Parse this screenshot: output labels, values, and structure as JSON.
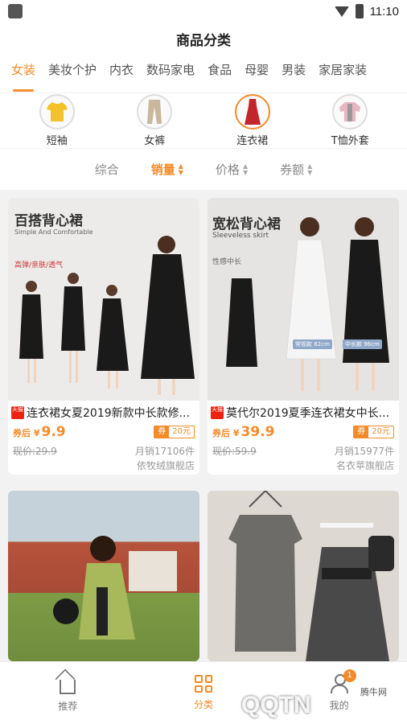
{
  "status_bar": {
    "time": "11:10"
  },
  "header": {
    "title": "商品分类"
  },
  "category_tabs": [
    {
      "label": "女装",
      "active": true
    },
    {
      "label": "美妆个护"
    },
    {
      "label": "内衣"
    },
    {
      "label": "数码家电"
    },
    {
      "label": "食品"
    },
    {
      "label": "母婴"
    },
    {
      "label": "男装"
    },
    {
      "label": "家居家装"
    }
  ],
  "sub_categories": [
    {
      "label": "短袖"
    },
    {
      "label": "女裤"
    },
    {
      "label": "连衣裙",
      "active": true
    },
    {
      "label": "T恤外套"
    }
  ],
  "sort_options": [
    {
      "label": "综合"
    },
    {
      "label": "销量",
      "active": true
    },
    {
      "label": "价格"
    },
    {
      "label": "券额"
    }
  ],
  "products": [
    {
      "image_title": "百搭背心裙",
      "image_subtitle": "Simple And Comfortable",
      "image_tag": "高弹/亲肤/透气",
      "badge": "天猫",
      "title": "连衣裙女夏2019新款中长款修...",
      "price_prefix": "券后 ¥",
      "price": "9.9",
      "coupon_label": "券",
      "coupon_value": "20元",
      "original_price": "现价:29.9",
      "monthly_sales": "月销17106件",
      "shop": "依牧绒旗舰店"
    },
    {
      "image_title": "宽松背心裙",
      "image_subtitle": "Sleeveless skirt",
      "image_tag": "性感中长",
      "image_label_a": "常规款 82cm",
      "image_label_b": "中长款 96cm",
      "badge": "天猫",
      "title": "莫代尔2019夏季连衣裙女中长...",
      "price_prefix": "券后 ¥",
      "price": "39.9",
      "coupon_label": "券",
      "coupon_value": "20元",
      "original_price": "现价:59.9",
      "monthly_sales": "月销15977件",
      "shop": "名衣苹旗舰店"
    },
    {
      "title": ""
    },
    {
      "title": ""
    }
  ],
  "tab_bar": [
    {
      "label": "推荐",
      "icon": "home-icon"
    },
    {
      "label": "分类",
      "icon": "grid-icon",
      "active": true
    },
    {
      "label": "我的",
      "icon": "user-icon",
      "badge": "1"
    }
  ],
  "watermark": {
    "text": "QQTN",
    "small": "腾牛网"
  }
}
